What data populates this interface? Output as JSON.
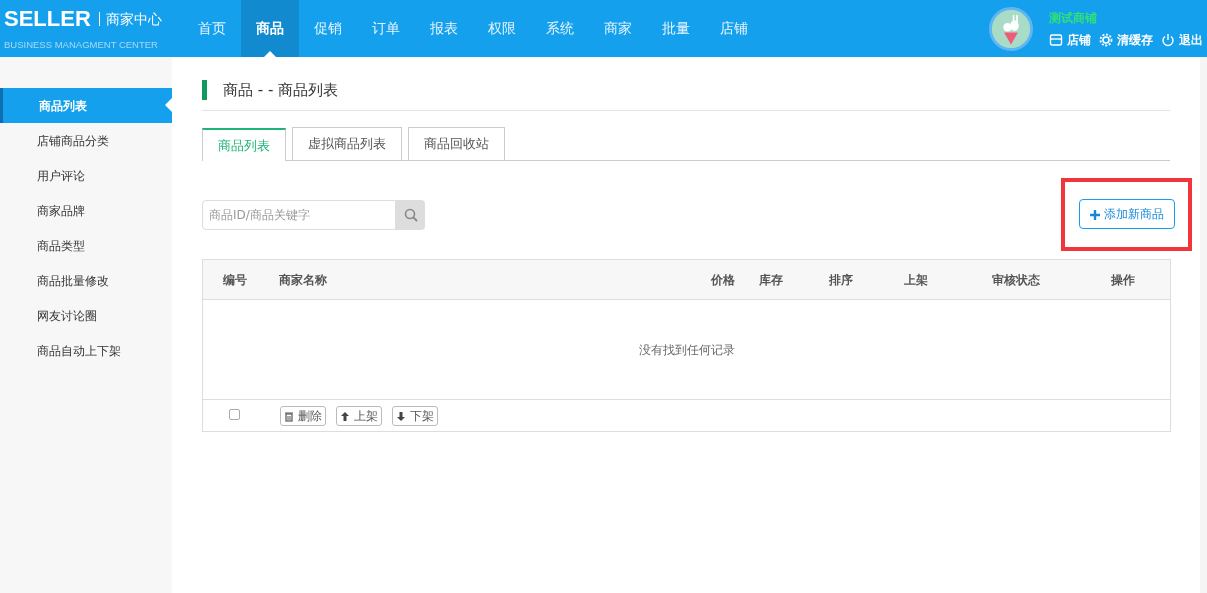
{
  "header": {
    "logo": "SELLER",
    "center_title": "商家中心",
    "subtitle": "BUSINESS MANAGMENT CENTER",
    "nav": [
      {
        "label": "首页",
        "selected": false
      },
      {
        "label": "商品",
        "selected": true
      },
      {
        "label": "促销",
        "selected": false
      },
      {
        "label": "订单",
        "selected": false
      },
      {
        "label": "报表",
        "selected": false
      },
      {
        "label": "权限",
        "selected": false
      },
      {
        "label": "系统",
        "selected": false
      },
      {
        "label": "商家",
        "selected": false
      },
      {
        "label": "批量",
        "selected": false
      },
      {
        "label": "店铺",
        "selected": false
      }
    ],
    "store_name": "测试商铺",
    "actions": [
      {
        "kind": "store",
        "label": "店铺"
      },
      {
        "kind": "cache",
        "label": "清缓存"
      },
      {
        "kind": "logout",
        "label": "退出"
      }
    ]
  },
  "sidebar": {
    "items": [
      {
        "label": "商品列表",
        "selected": true
      },
      {
        "label": "店铺商品分类",
        "selected": false
      },
      {
        "label": "用户评论",
        "selected": false
      },
      {
        "label": "商家品牌",
        "selected": false
      },
      {
        "label": "商品类型",
        "selected": false
      },
      {
        "label": "商品批量修改",
        "selected": false
      },
      {
        "label": "网友讨论圈",
        "selected": false
      },
      {
        "label": "商品自动上下架",
        "selected": false
      }
    ]
  },
  "page_title": "商品 - - 商品列表",
  "tabs": [
    {
      "label": "商品列表",
      "selected": true
    },
    {
      "label": "虚拟商品列表",
      "selected": false
    },
    {
      "label": "商品回收站",
      "selected": false
    }
  ],
  "search": {
    "placeholder": "商品ID/商品关键字"
  },
  "add_button": {
    "label": "添加新商品",
    "highlighted": true
  },
  "table": {
    "columns": [
      "编号",
      "商家名称",
      "价格",
      "库存",
      "排序",
      "上架",
      "审核状态",
      "操作"
    ],
    "empty_message": "没有找到任何记录",
    "footer": {
      "select_all_checked": false,
      "actions": [
        {
          "kind": "delete",
          "label": "删除"
        },
        {
          "kind": "up",
          "label": "上架"
        },
        {
          "kind": "down",
          "label": "下架"
        }
      ]
    }
  }
}
